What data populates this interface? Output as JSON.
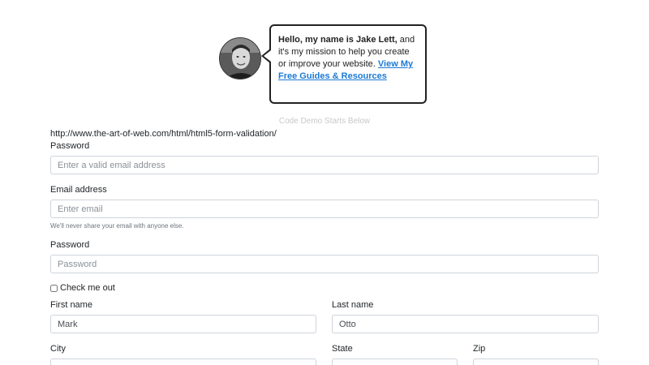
{
  "intro": {
    "greeting_bold": "Hello, my name is Jake Lett,",
    "greeting_rest": " and it's my mission to help you create or improve your website. ",
    "link_text": "View My Free Guides & Resources"
  },
  "demo_note": "Code Demo Starts Below",
  "source_url": "http://www.the-art-of-web.com/html/html5-form-validation/",
  "form": {
    "password_top": {
      "label": "Password",
      "placeholder": "Enter a valid email address",
      "value": ""
    },
    "email": {
      "label": "Email address",
      "placeholder": "Enter email",
      "value": "",
      "help": "We'll never share your email with anyone else."
    },
    "password": {
      "label": "Password",
      "placeholder": "Password",
      "value": ""
    },
    "check": {
      "label": "Check me out",
      "checked": false
    },
    "first_name": {
      "label": "First name",
      "value": "Mark"
    },
    "last_name": {
      "label": "Last name",
      "value": "Otto"
    },
    "city": {
      "label": "City",
      "value": ""
    },
    "state": {
      "label": "State",
      "value": ""
    },
    "zip": {
      "label": "Zip",
      "value": ""
    }
  }
}
